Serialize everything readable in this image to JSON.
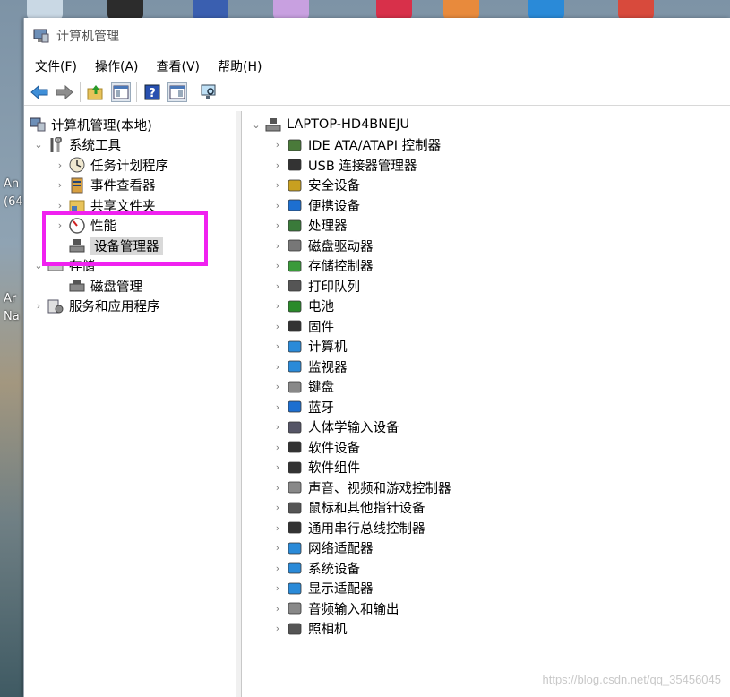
{
  "window": {
    "title": "计算机管理"
  },
  "menu": [
    "文件(F)",
    "操作(A)",
    "查看(V)",
    "帮助(H)"
  ],
  "desktop_labels": [
    "An",
    "(64",
    "Ar",
    "Na"
  ],
  "left_tree": {
    "root": "计算机管理(本地)",
    "items": [
      {
        "label": "系统工具",
        "level": 1,
        "expanded": true
      },
      {
        "label": "任务计划程序",
        "level": 2
      },
      {
        "label": "事件查看器",
        "level": 2
      },
      {
        "label": "共享文件夹",
        "level": 2
      },
      {
        "label": "性能",
        "level": 2
      },
      {
        "label": "设备管理器",
        "level": 2,
        "selected": true
      },
      {
        "label": "存储",
        "level": 1,
        "expanded": true
      },
      {
        "label": "磁盘管理",
        "level": 2
      },
      {
        "label": "服务和应用程序",
        "level": 1
      }
    ]
  },
  "right_tree": {
    "root": "LAPTOP-HD4BNEJU",
    "items": [
      "IDE ATA/ATAPI 控制器",
      "USB 连接器管理器",
      "安全设备",
      "便携设备",
      "处理器",
      "磁盘驱动器",
      "存储控制器",
      "打印队列",
      "电池",
      "固件",
      "计算机",
      "监视器",
      "键盘",
      "蓝牙",
      "人体学输入设备",
      "软件设备",
      "软件组件",
      "声音、视频和游戏控制器",
      "鼠标和其他指针设备",
      "通用串行总线控制器",
      "网络适配器",
      "系统设备",
      "显示适配器",
      "音频输入和输出",
      "照相机"
    ]
  },
  "watermark": "https://blog.csdn.net/qq_35456045",
  "colors": {
    "highlight_box": "#f021f0",
    "selected_bg": "#d9d9d9"
  }
}
